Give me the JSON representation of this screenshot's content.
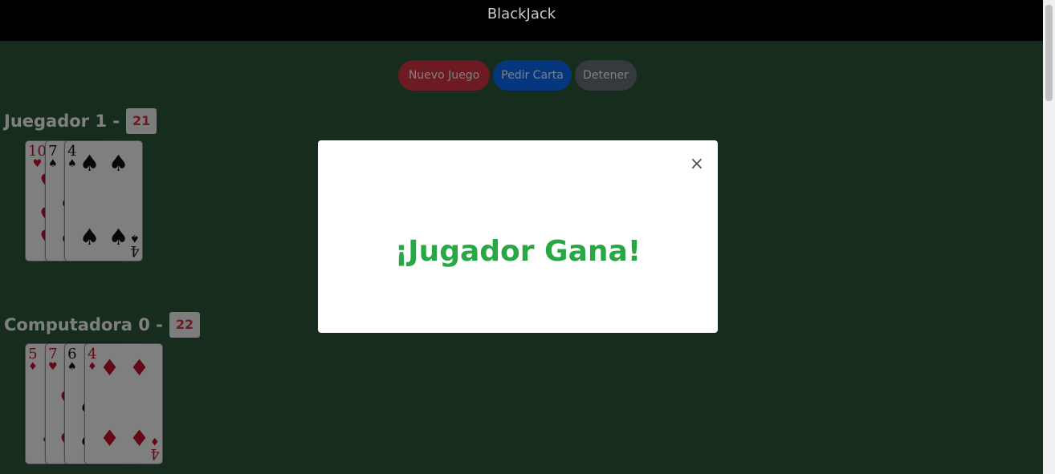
{
  "header": {
    "title": "BlackJack"
  },
  "controls": {
    "new_game": "Nuevo Juego",
    "hit": "Pedir Carta",
    "stop": "Detener"
  },
  "player": {
    "title": "Juegador 1 -",
    "score": "21",
    "cards": [
      {
        "rank": "10",
        "suit": "♥",
        "color": "red"
      },
      {
        "rank": "7",
        "suit": "♠",
        "color": "black"
      },
      {
        "rank": "4",
        "suit": "♠",
        "color": "black"
      }
    ]
  },
  "computer": {
    "title": "Computadora 0 -",
    "score": "22",
    "cards": [
      {
        "rank": "5",
        "suit": "♦",
        "color": "red"
      },
      {
        "rank": "7",
        "suit": "♥",
        "color": "red"
      },
      {
        "rank": "6",
        "suit": "♠",
        "color": "black"
      },
      {
        "rank": "4",
        "suit": "♦",
        "color": "red"
      }
    ]
  },
  "modal": {
    "close": "×",
    "message": "¡Jugador Gana!"
  },
  "colors": {
    "table": "#2d5a3d",
    "danger": "#dc3545",
    "primary": "#0d6efd",
    "secondary": "#6c757d",
    "success": "#28a745"
  }
}
